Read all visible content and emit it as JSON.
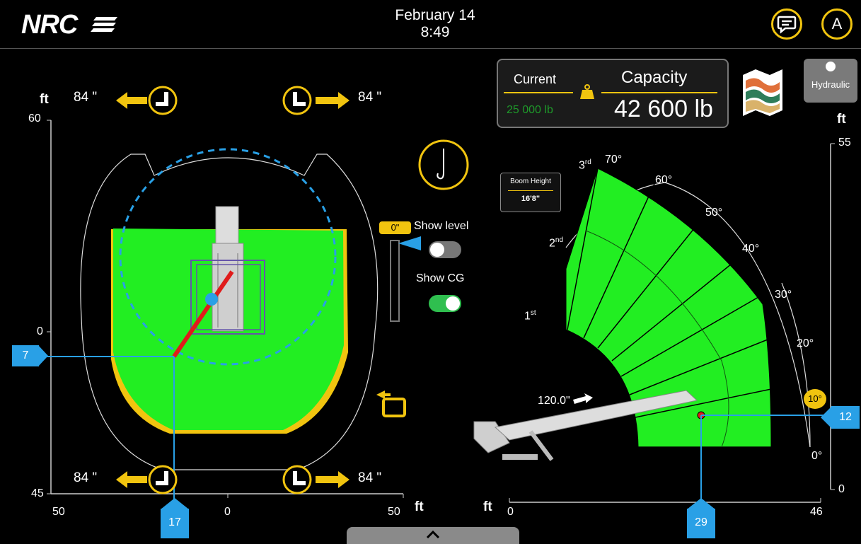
{
  "header": {
    "logo": "NRC",
    "date": "February 14",
    "time": "8:49",
    "chat_icon": "chat-icon",
    "user_initial": "A"
  },
  "capacity": {
    "current_label": "Current",
    "current_value": "25 000 lb",
    "capacity_label": "Capacity",
    "capacity_value": "42 600 lb",
    "weight_icon": "weight-icon"
  },
  "map_icon": "map-icon",
  "hydraulic": {
    "label": "Hydraulic"
  },
  "left_chart": {
    "unit": "ft",
    "y_ticks": [
      "60",
      "0",
      "45"
    ],
    "x_ticks": [
      "50",
      "0",
      "50"
    ],
    "x_unit": "ft",
    "outriggers": {
      "front_left": "84 \"",
      "front_right": "84 \"",
      "rear_left": "84 \"",
      "rear_right": "84 \""
    },
    "y_marker": "7",
    "x_marker": "17",
    "rotate_icon": "rotate-icon"
  },
  "controls": {
    "hook_icon": "hook-icon",
    "level_value": "0\"",
    "show_level_label": "Show level",
    "show_level_on": false,
    "show_cg_label": "Show CG",
    "show_cg_on": true
  },
  "right_chart": {
    "y_unit": "ft",
    "x_unit": "ft",
    "y_ticks": [
      "55",
      "0"
    ],
    "x_ticks": [
      "0",
      "46"
    ],
    "boom_height_label": "Boom Height",
    "boom_height_value": "16'8\"",
    "angles": [
      "70°",
      "60°",
      "50°",
      "40°",
      "30°",
      "20°",
      "10°",
      "0°"
    ],
    "sections": [
      "1",
      "2",
      "3"
    ],
    "sections_sup": [
      "st",
      "nd",
      "rd"
    ],
    "extension": "120.0\"",
    "y_marker": "12",
    "x_marker": "29",
    "highlight_angle": "10°"
  },
  "colors": {
    "accent": "#f1c40f",
    "green": "#22ee22",
    "blue": "#29a0e6",
    "red": "#e01b1b"
  }
}
